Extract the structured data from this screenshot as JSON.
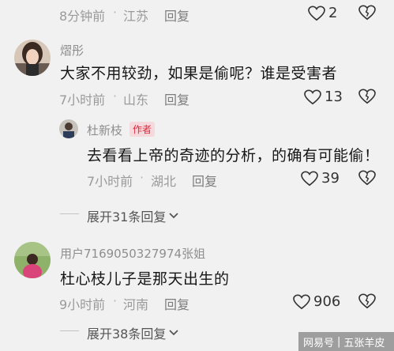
{
  "comments": [
    {
      "time": "8分钟前",
      "location": "江苏",
      "reply_label": "回复",
      "likes": "2"
    },
    {
      "username": "熠彤",
      "text": "大家不用较劲，如果是偷呢？谁是受害者",
      "time": "7小时前",
      "location": "山东",
      "reply_label": "回复",
      "likes": "13",
      "replies": [
        {
          "username": "杜新枝",
          "badge": "作者",
          "text": "去看看上帝的奇迹的分析，的确有可能偷！",
          "time": "7小时前",
          "location": "湖北",
          "reply_label": "回复",
          "likes": "39"
        }
      ],
      "expand_label": "展开31条回复"
    },
    {
      "username": "用户7169050327974张姐",
      "text": "杜心枝儿子是那天出生的",
      "time": "9小时前",
      "location": "河南",
      "reply_label": "回复",
      "likes": "906",
      "expand_label": "展开38条回复"
    }
  ],
  "watermark": {
    "brand": "网易号",
    "account": "五张羊皮"
  },
  "colors": {
    "background": "#f1f1f1",
    "author_badge_text": "#e0283c",
    "author_badge_bg": "#f5d9dc"
  },
  "icons": [
    "heart-icon",
    "dislike-heart-icon",
    "chevron-down-icon"
  ]
}
